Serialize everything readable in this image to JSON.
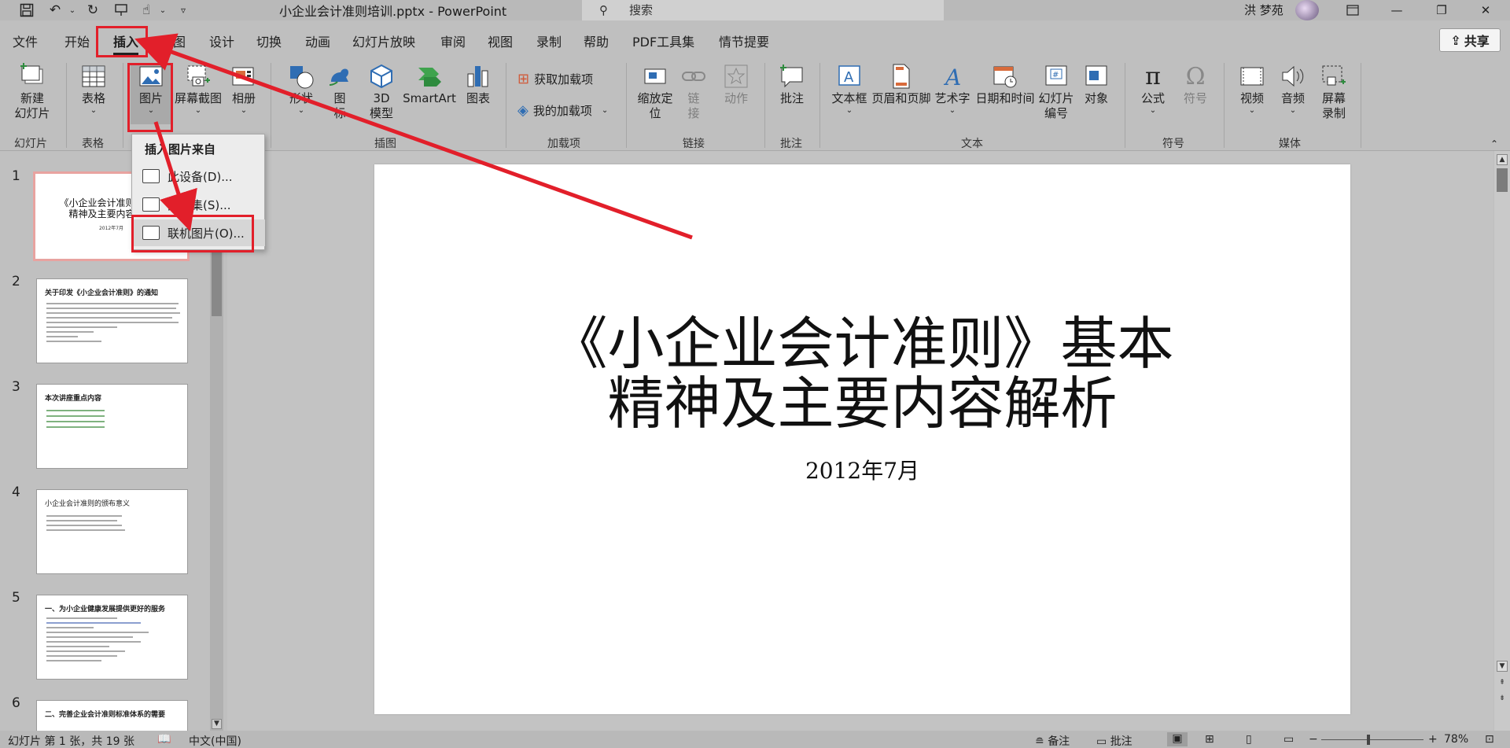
{
  "title_bar": {
    "document_title": "小企业会计准则培训.pptx  -  PowerPoint",
    "search_placeholder": "搜索",
    "user_name": "洪 梦苑",
    "icons": [
      "save-icon",
      "undo-icon",
      "redo-icon",
      "present-icon",
      "touch-mode-icon",
      "customize-icon"
    ]
  },
  "menu": {
    "tabs": [
      "文件",
      "开始",
      "插入",
      "绘图",
      "设计",
      "切换",
      "动画",
      "幻灯片放映",
      "审阅",
      "视图",
      "录制",
      "帮助",
      "PDF工具集",
      "情节提要"
    ],
    "active_tab": "插入",
    "share_label": "共享"
  },
  "ribbon": {
    "new_slide": "新建\n幻灯片",
    "table": "表格",
    "picture": "图片",
    "screenshot": "屏幕截图",
    "album": "相册",
    "shapes": "形状",
    "icons": "图\n标",
    "model3d": "3D\n模型",
    "smartart": "SmartArt",
    "chart": "图表",
    "get_addins": "获取加载项",
    "my_addins": "我的加载项",
    "zoom": "缩放定\n位",
    "link": "链\n接",
    "action": "动作",
    "comment": "批注",
    "textbox": "文本框",
    "header_footer": "页眉和页脚",
    "wordart": "艺术字",
    "datetime": "日期和时间",
    "slide_number": "幻灯片\n编号",
    "object": "对象",
    "equation": "公式",
    "symbol": "符号",
    "video": "视频",
    "audio": "音频",
    "screen_record": "屏幕\n录制",
    "groups": {
      "slides": "幻灯片",
      "tables": "表格",
      "illustrations": "插图",
      "addins": "加载项",
      "links": "链接",
      "comments": "批注",
      "text": "文本",
      "symbols": "符号",
      "media": "媒体"
    }
  },
  "picture_dropdown": {
    "header": "插入图片来自",
    "items": [
      "此设备(D)...",
      "图像集(S)...",
      "联机图片(O)..."
    ],
    "hovered_index": 2
  },
  "slides_panel": {
    "slides": [
      {
        "number": "1",
        "title": "《小企业会计准则》基本\n精神及主要内容解析",
        "sub": "2012年7月"
      },
      {
        "number": "2",
        "title": "关于印发《小企业会计准则》的通知"
      },
      {
        "number": "3",
        "title": "本次讲座重点内容"
      },
      {
        "number": "4",
        "title": "小企业会计准则的颁布意义"
      },
      {
        "number": "5",
        "title": "一、为小企业健康发展提供更好的服务"
      },
      {
        "number": "6",
        "title": "二、完善企业会计准则标准体系的需要"
      }
    ],
    "selected_index": 0
  },
  "slide": {
    "title": "《小企业会计准则》基本\n精神及主要内容解析",
    "subtitle": "2012年7月"
  },
  "status_bar": {
    "slide_info": "幻灯片 第 1 张，共 19 张",
    "language": "中文(中国)",
    "notes": "备注",
    "comments": "批注",
    "zoom": "78%"
  },
  "annotation_color": "#e21f2a"
}
